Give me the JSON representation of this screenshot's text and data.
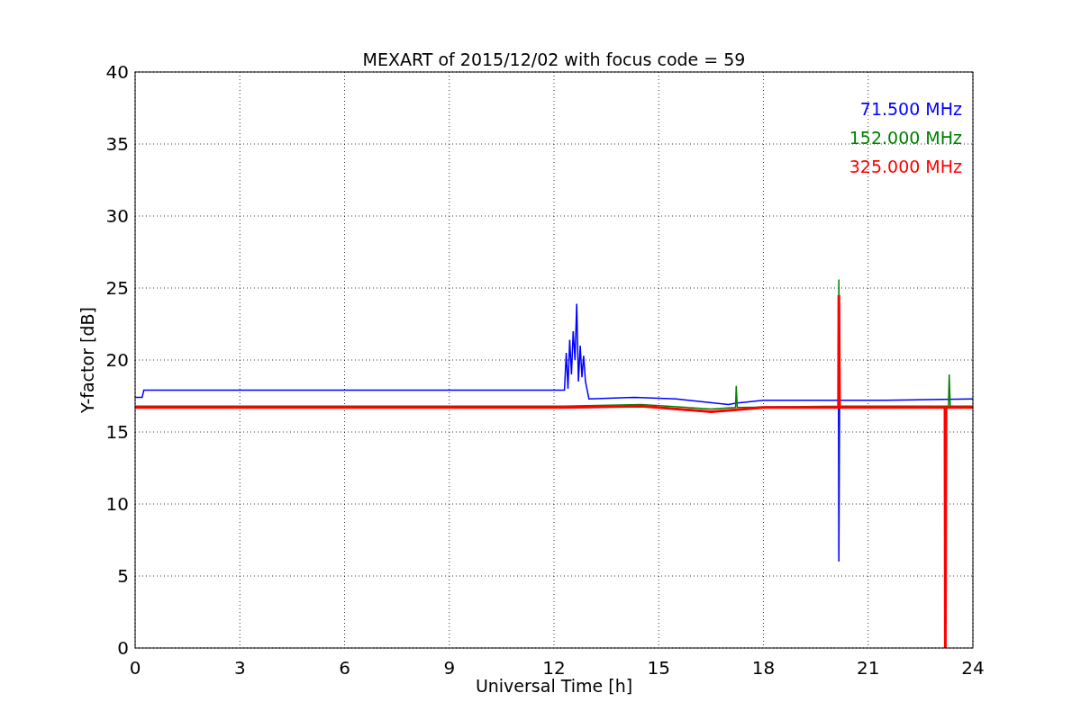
{
  "figure": {
    "chart_data": {
      "type": "line",
      "grid": true,
      "title": "MEXART of 2015/12/02 with focus code = 59",
      "xlabel": "Universal Time [h]",
      "ylabel": "Y-factor [dB]",
      "xlim": [
        0,
        24
      ],
      "ylim": [
        0,
        40
      ],
      "xticks": [
        0,
        3,
        6,
        9,
        12,
        15,
        18,
        21,
        24
      ],
      "yticks": [
        0,
        5,
        10,
        15,
        20,
        25,
        30,
        35,
        40
      ],
      "series": [
        {
          "name": "71.500 MHz",
          "color": "#0000ff",
          "x": [
            0,
            0.2,
            0.25,
            12.3,
            12.35,
            12.4,
            12.45,
            12.5,
            12.55,
            12.6,
            12.65,
            12.7,
            12.75,
            12.8,
            12.85,
            12.9,
            13.0,
            14.3,
            15.5,
            17,
            17.2,
            18,
            20.15,
            20.16,
            20.18,
            21.5,
            24
          ],
          "values": [
            17.4,
            17.4,
            17.9,
            17.9,
            20.5,
            18,
            21.4,
            19,
            22,
            20,
            23.9,
            18.5,
            21,
            18.8,
            20.3,
            18.5,
            17.3,
            17.4,
            17.3,
            16.9,
            17.0,
            17.2,
            17.2,
            6,
            17.2,
            17.2,
            17.3
          ]
        },
        {
          "name": "152.000 MHz",
          "color": "#008000",
          "x": [
            0,
            12.3,
            14.5,
            16.5,
            17.2,
            17.22,
            17.25,
            20.15,
            20.16,
            20.18,
            23.3,
            23.32,
            23.35,
            24
          ],
          "values": [
            16.8,
            16.8,
            16.9,
            16.6,
            16.7,
            18.2,
            16.7,
            16.8,
            25.6,
            16.8,
            16.8,
            19,
            16.8,
            16.8
          ]
        },
        {
          "name": "325.000 MHz",
          "color": "#ff0000",
          "x": [
            0,
            12.3,
            14.5,
            16.5,
            17,
            18,
            20.15,
            20.16,
            20.18,
            23.2,
            23.21,
            23.23,
            24
          ],
          "values": [
            16.7,
            16.7,
            16.8,
            16.4,
            16.5,
            16.7,
            16.7,
            24.5,
            16.7,
            16.7,
            0,
            16.7,
            16.7
          ]
        }
      ]
    }
  }
}
